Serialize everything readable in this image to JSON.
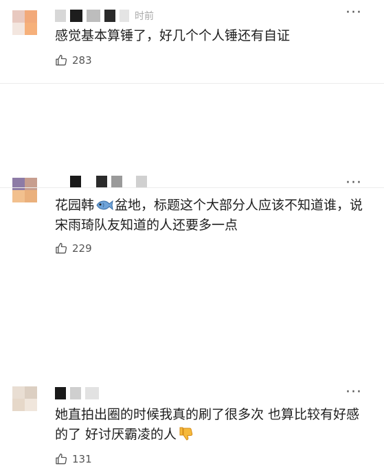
{
  "comments": [
    {
      "time": "时前",
      "text": "感觉基本算锤了，好几个个人锤还有自证",
      "likes": "283"
    },
    {
      "time": "",
      "text_before_fish": "花园韩",
      "text_after_fish": "盆地，标题这个大部分人应该不知道谁，说宋雨琦队友知道的人还要多一点",
      "likes": "229"
    },
    {
      "time": "",
      "text": "她直拍出圈的时候我真的刷了很多次 也算比较有好感的了  好讨厌霸凌的人",
      "likes": "131"
    }
  ],
  "icons": {
    "like": "thumbs-up-outline-icon",
    "more": "more-dots-icon",
    "fish": "fish-emoji-icon",
    "thumbs_down": "thumbs-down-emoji-icon"
  },
  "more_label": "···",
  "colors": {
    "text": "#1e1e1e",
    "meta": "#555555",
    "divider": "#ececec",
    "emoji_yellow": "#f6b93b"
  }
}
